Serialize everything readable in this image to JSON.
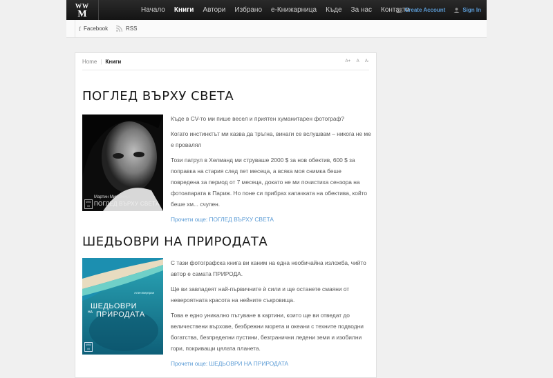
{
  "logo": {
    "line1": "WW",
    "line2": "M"
  },
  "nav": {
    "items": [
      {
        "label": "Начало",
        "active": false
      },
      {
        "label": "Книги",
        "active": true
      },
      {
        "label": "Автори",
        "active": false
      },
      {
        "label": "Избрано",
        "active": false
      },
      {
        "label": "е-Книжарница",
        "active": false
      },
      {
        "label": "Къде",
        "active": false
      },
      {
        "label": "За нас",
        "active": false
      },
      {
        "label": "Контакти",
        "active": false
      }
    ]
  },
  "account": {
    "create_label": "Create Account",
    "signin_label": "Sign In"
  },
  "social": {
    "facebook": "Facebook",
    "rss": "RSS"
  },
  "breadcrumb": {
    "home": "Home",
    "current": "Книги"
  },
  "font_size": {
    "larger": "A+",
    "normal": "A",
    "smaller": "A-"
  },
  "articles": [
    {
      "title": "ПОГЛЕД ВЪРХУ СВЕТА",
      "cover": {
        "author": "Мартин Миразчиук",
        "title": "ПОГЛЕД ВЪРХУ СВЕТА",
        "badge": "WW M"
      },
      "paragraphs": [
        "Къде в CV-то ми пише весел и приятен хуманитарен фотограф?",
        "Когато инстинктът ми казва да тръгна, винаги се вслушвам – никога не ме е провалял",
        "Този патрул в Хелманд ми струваше 2000 $ за нов обектив, 600 $ за поправка на стария след пет месеца, а всяка моя снимка беше повредена за период от 7 месеца, докато не ми почистиха сензора на фотоапарата в Париж. Но поне си прибрах капачката на обектива, който беше хм... счупен."
      ],
      "read_more": "Прочети още: ПОГЛЕД ВЪРХУ СВЕТА"
    },
    {
      "title": "ШЕДЬОВРИ НА ПРИРОДАТА",
      "cover": {
        "author": "Ален Бертран",
        "title_line1": "ШЕДЬОВРИ",
        "title_small": "НА",
        "title_line2": "ПРИРОДАТА",
        "badge": "WW M"
      },
      "paragraphs": [
        "С тази фотографска книга ви каним на една необичайна изложба, чийто автор е самата ПРИРОДА.",
        "Ще ви завладеят най-първичните ѝ сили и ще останете смаяни от невероятната красота на нейните съкровища.",
        "Това е едно уникално пътуване в картини, които ще ви отведат до величествени върхове, безбрежни морета и океани с техните подводни богатства, безпределни пустини, безгранични ледени земи и изобилни гори, покриващи цялата планета."
      ],
      "read_more": "Прочети още: ШЕДЬОВРИ НА ПРИРОДАТА"
    }
  ],
  "colors": {
    "accent": "#5b9bd5",
    "topbar": "#1c1c1c",
    "background": "#f0f0f0"
  }
}
